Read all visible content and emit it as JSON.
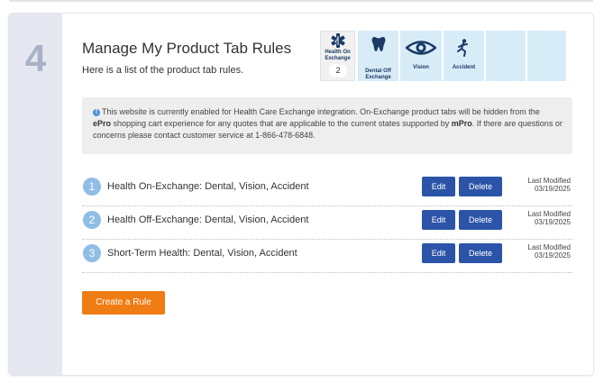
{
  "step": {
    "number": "4"
  },
  "header": {
    "title": "Manage My Product Tab Rules",
    "subtitle": "Here is a list of the product tab rules."
  },
  "tabs": [
    {
      "label": "Health On Exchange",
      "badge": "2",
      "icon": "medical-star-icon",
      "selected": true
    },
    {
      "label": "Dental Off Exchange",
      "icon": "tooth-icon"
    },
    {
      "label": "Vision",
      "icon": "eye-icon"
    },
    {
      "label": "Accident",
      "icon": "accident-icon"
    },
    {
      "label": ""
    },
    {
      "label": ""
    }
  ],
  "notice": {
    "icon": "info-icon",
    "text_1": "This website is currently enabled for Health Care Exchange integration. On-Exchange product tabs will be hidden from the",
    "brand_1": "ePro",
    "text_2": " shopping cart experience for any quotes that are applicable to the current states supported by ",
    "brand_2": "mPro",
    "text_3": ". If there are questions or concerns please contact customer service at 1-866-478-6848."
  },
  "rules": [
    {
      "number": "1",
      "label": "Health On-Exchange: Dental, Vision, Accident",
      "edit": "Edit",
      "delete": "Delete",
      "modified_label": "Last Modified",
      "modified_date": "03/19/2025"
    },
    {
      "number": "2",
      "label": "Health Off-Exchange: Dental, Vision, Accident",
      "edit": "Edit",
      "delete": "Delete",
      "modified_label": "Last Modified",
      "modified_date": "03/19/2025"
    },
    {
      "number": "3",
      "label": "Short-Term Health: Dental, Vision, Accident",
      "edit": "Edit",
      "delete": "Delete",
      "modified_label": "Last Modified",
      "modified_date": "03/19/2025"
    }
  ],
  "create_button": "Create a Rule",
  "colors": {
    "primary_button": "#2b54a8",
    "accent_orange": "#f07c14",
    "rule_number": "#90bde6",
    "tab_bg": "#d8ecf8",
    "icon_navy": "#1b3a66"
  }
}
